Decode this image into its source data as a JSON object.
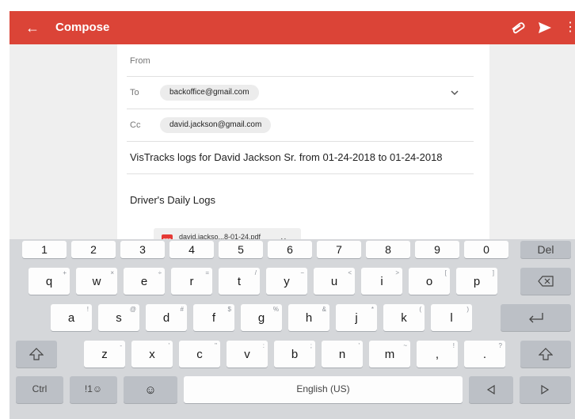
{
  "appbar": {
    "title": "Compose"
  },
  "compose": {
    "from_label": "From",
    "to_label": "To",
    "to_chip": "backoffice@gmail.com",
    "cc_label": "Cc",
    "cc_chip": "david.jackson@gmail.com",
    "subject": "VisTracks logs for David Jackson Sr. from 01-24-2018 to 01-24-2018",
    "body": "Driver's Daily Logs",
    "attachment": {
      "file_name": "david.jackso...8-01-24.pdf",
      "file_type": "PDF"
    }
  },
  "keyboard": {
    "number_row": [
      "1",
      "2",
      "3",
      "4",
      "5",
      "6",
      "7",
      "8",
      "9",
      "0"
    ],
    "del_label": "Del",
    "row1": [
      "q",
      "w",
      "e",
      "r",
      "t",
      "y",
      "u",
      "i",
      "o",
      "p"
    ],
    "row1_alt": [
      "+",
      "×",
      "÷",
      "=",
      "/",
      "−",
      "<",
      ">",
      "[",
      "]"
    ],
    "row2": [
      "a",
      "s",
      "d",
      "f",
      "g",
      "h",
      "j",
      "k",
      "l"
    ],
    "row2_alt": [
      "!",
      "@",
      "#",
      "$",
      "%",
      "&",
      "*",
      "(",
      ")"
    ],
    "row3": [
      "z",
      "x",
      "c",
      "v",
      "b",
      "n",
      "m",
      ",",
      "."
    ],
    "row3_alt": [
      "-",
      "'",
      "\"",
      ":",
      ";",
      "'",
      "~",
      "!",
      "?"
    ],
    "ctrl_label": "Ctrl",
    "symbols_label": "!1☺",
    "emoji_label": "☺",
    "space_label": "English (US)"
  },
  "icons": {
    "back": "arrow-left-icon",
    "attach": "paperclip-icon",
    "send": "send-icon",
    "more": "overflow-menu-icon",
    "chevron": "chevron-down-icon",
    "pdf": "pdf-file-icon",
    "close": "close-icon",
    "backspace": "backspace-icon",
    "enter": "enter-icon",
    "shift": "shift-icon",
    "left": "arrow-left-key-icon",
    "right": "arrow-right-key-icon"
  },
  "colors": {
    "appbar": "#db4437",
    "keyboard_bg": "#d5d7da",
    "key": "#fdfdfd"
  }
}
